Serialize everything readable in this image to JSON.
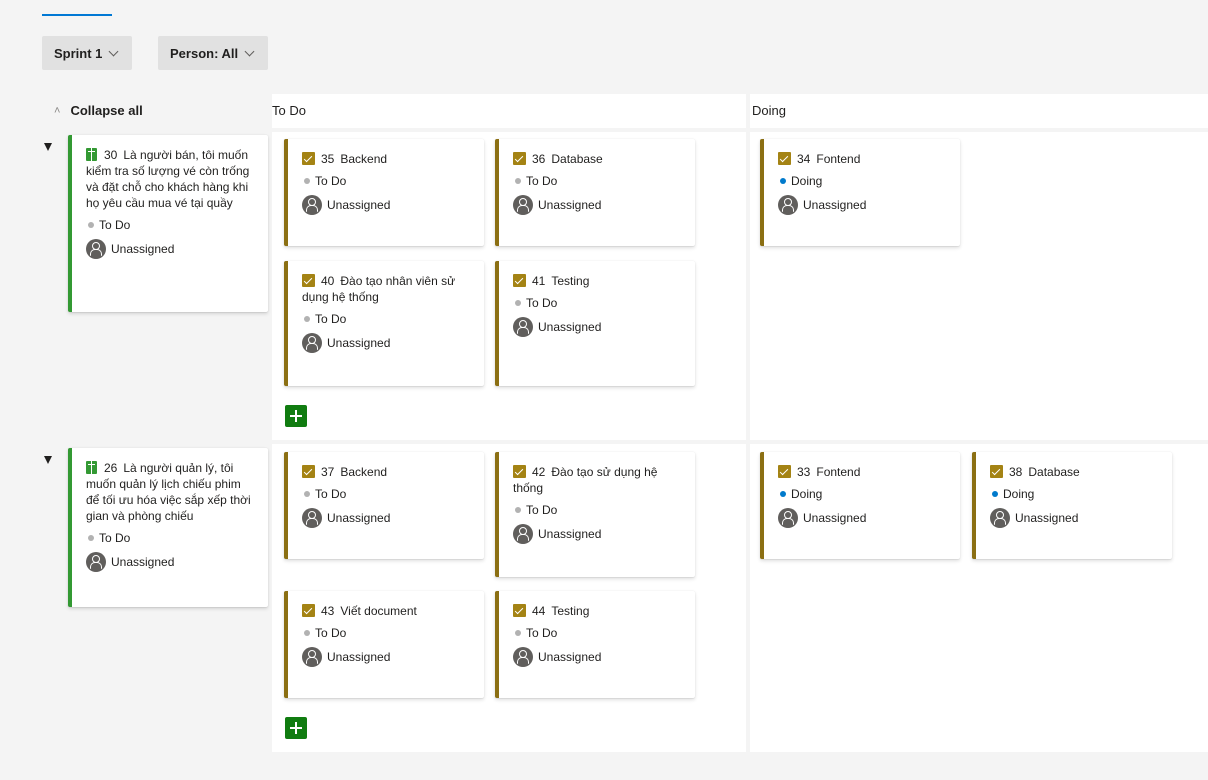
{
  "filters": {
    "sprint_label": "Sprint 1",
    "person_label": "Person: All"
  },
  "header": {
    "collapse_all_label": "Collapse all",
    "columns": [
      "To Do",
      "Doing"
    ]
  },
  "colors": {
    "task_accent": "#8b6f13",
    "story_accent": "#339933",
    "add_button": "#107c10",
    "doing_dot": "#007acc",
    "todo_dot": "#b2b2b2"
  },
  "lanes": [
    {
      "story": {
        "id": "30",
        "title": "Là người bán, tôi muốn kiểm tra số lượng vé còn trống và đặt chỗ cho khách hàng khi họ yêu cầu mua vé tại quầy",
        "state": "To Do",
        "assignee": "Unassigned"
      },
      "todo": [
        {
          "id": "35",
          "title": "Backend",
          "state": "To Do",
          "assignee": "Unassigned"
        },
        {
          "id": "36",
          "title": "Database",
          "state": "To Do",
          "assignee": "Unassigned"
        },
        {
          "id": "40",
          "title": "Đào tạo nhân viên sử dụng hệ thống",
          "state": "To Do",
          "assignee": "Unassigned"
        },
        {
          "id": "41",
          "title": "Testing",
          "state": "To Do",
          "assignee": "Unassigned"
        }
      ],
      "doing": [
        {
          "id": "34",
          "title": "Fontend",
          "state": "Doing",
          "assignee": "Unassigned"
        }
      ]
    },
    {
      "story": {
        "id": "26",
        "title": "Là người quản lý, tôi muốn quản lý lịch chiếu phim để tối ưu hóa việc sắp xếp thời gian và phòng chiếu",
        "state": "To Do",
        "assignee": "Unassigned"
      },
      "todo": [
        {
          "id": "37",
          "title": "Backend",
          "state": "To Do",
          "assignee": "Unassigned"
        },
        {
          "id": "42",
          "title": "Đào tạo sử dụng hệ thống",
          "state": "To Do",
          "assignee": "Unassigned"
        },
        {
          "id": "43",
          "title": "Viết document",
          "state": "To Do",
          "assignee": "Unassigned"
        },
        {
          "id": "44",
          "title": "Testing",
          "state": "To Do",
          "assignee": "Unassigned"
        }
      ],
      "doing": [
        {
          "id": "33",
          "title": "Fontend",
          "state": "Doing",
          "assignee": "Unassigned"
        },
        {
          "id": "38",
          "title": "Database",
          "state": "Doing",
          "assignee": "Unassigned"
        }
      ]
    }
  ]
}
